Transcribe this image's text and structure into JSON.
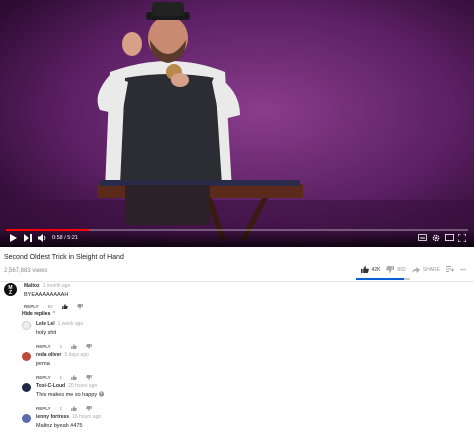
{
  "video": {
    "time_display": "0:58 / 5:21",
    "progress_fraction": 0.18,
    "title": "Second Oldest Trick in Sleight of Hand",
    "views": "2,567,883 views",
    "like_count": "42K",
    "dislike_count": "892",
    "share_label": "SHARE"
  },
  "comments": [
    {
      "author": "Maltoz",
      "ago": "1 month ago",
      "text": "BYEAAAAAAAAH",
      "like_count": "92",
      "reply_label": "REPLY",
      "avatar_text": "M\nZ"
    }
  ],
  "hide_replies_label": "Hide replies",
  "replies": [
    {
      "author": "Lele Lel",
      "ago": "1 week ago",
      "text": "holy shit",
      "like_count": "",
      "reply_label": "REPLY"
    },
    {
      "author": "reda oliver",
      "ago": "3 days ago",
      "text": "jerma",
      "like_count": "1",
      "reply_label": "REPLY"
    },
    {
      "author": "Toxi-C-Loud",
      "ago": "20 hours ago",
      "text": "This makes me so happy 😄",
      "like_count": "1",
      "reply_label": "REPLY"
    },
    {
      "author": "lenny fortress",
      "ago": "16 hours ago",
      "text": "Maltoz byeah #475",
      "like_count": "",
      "reply_label": "REPLY"
    }
  ],
  "reply_like_counts": [
    "1",
    "1",
    "1"
  ]
}
